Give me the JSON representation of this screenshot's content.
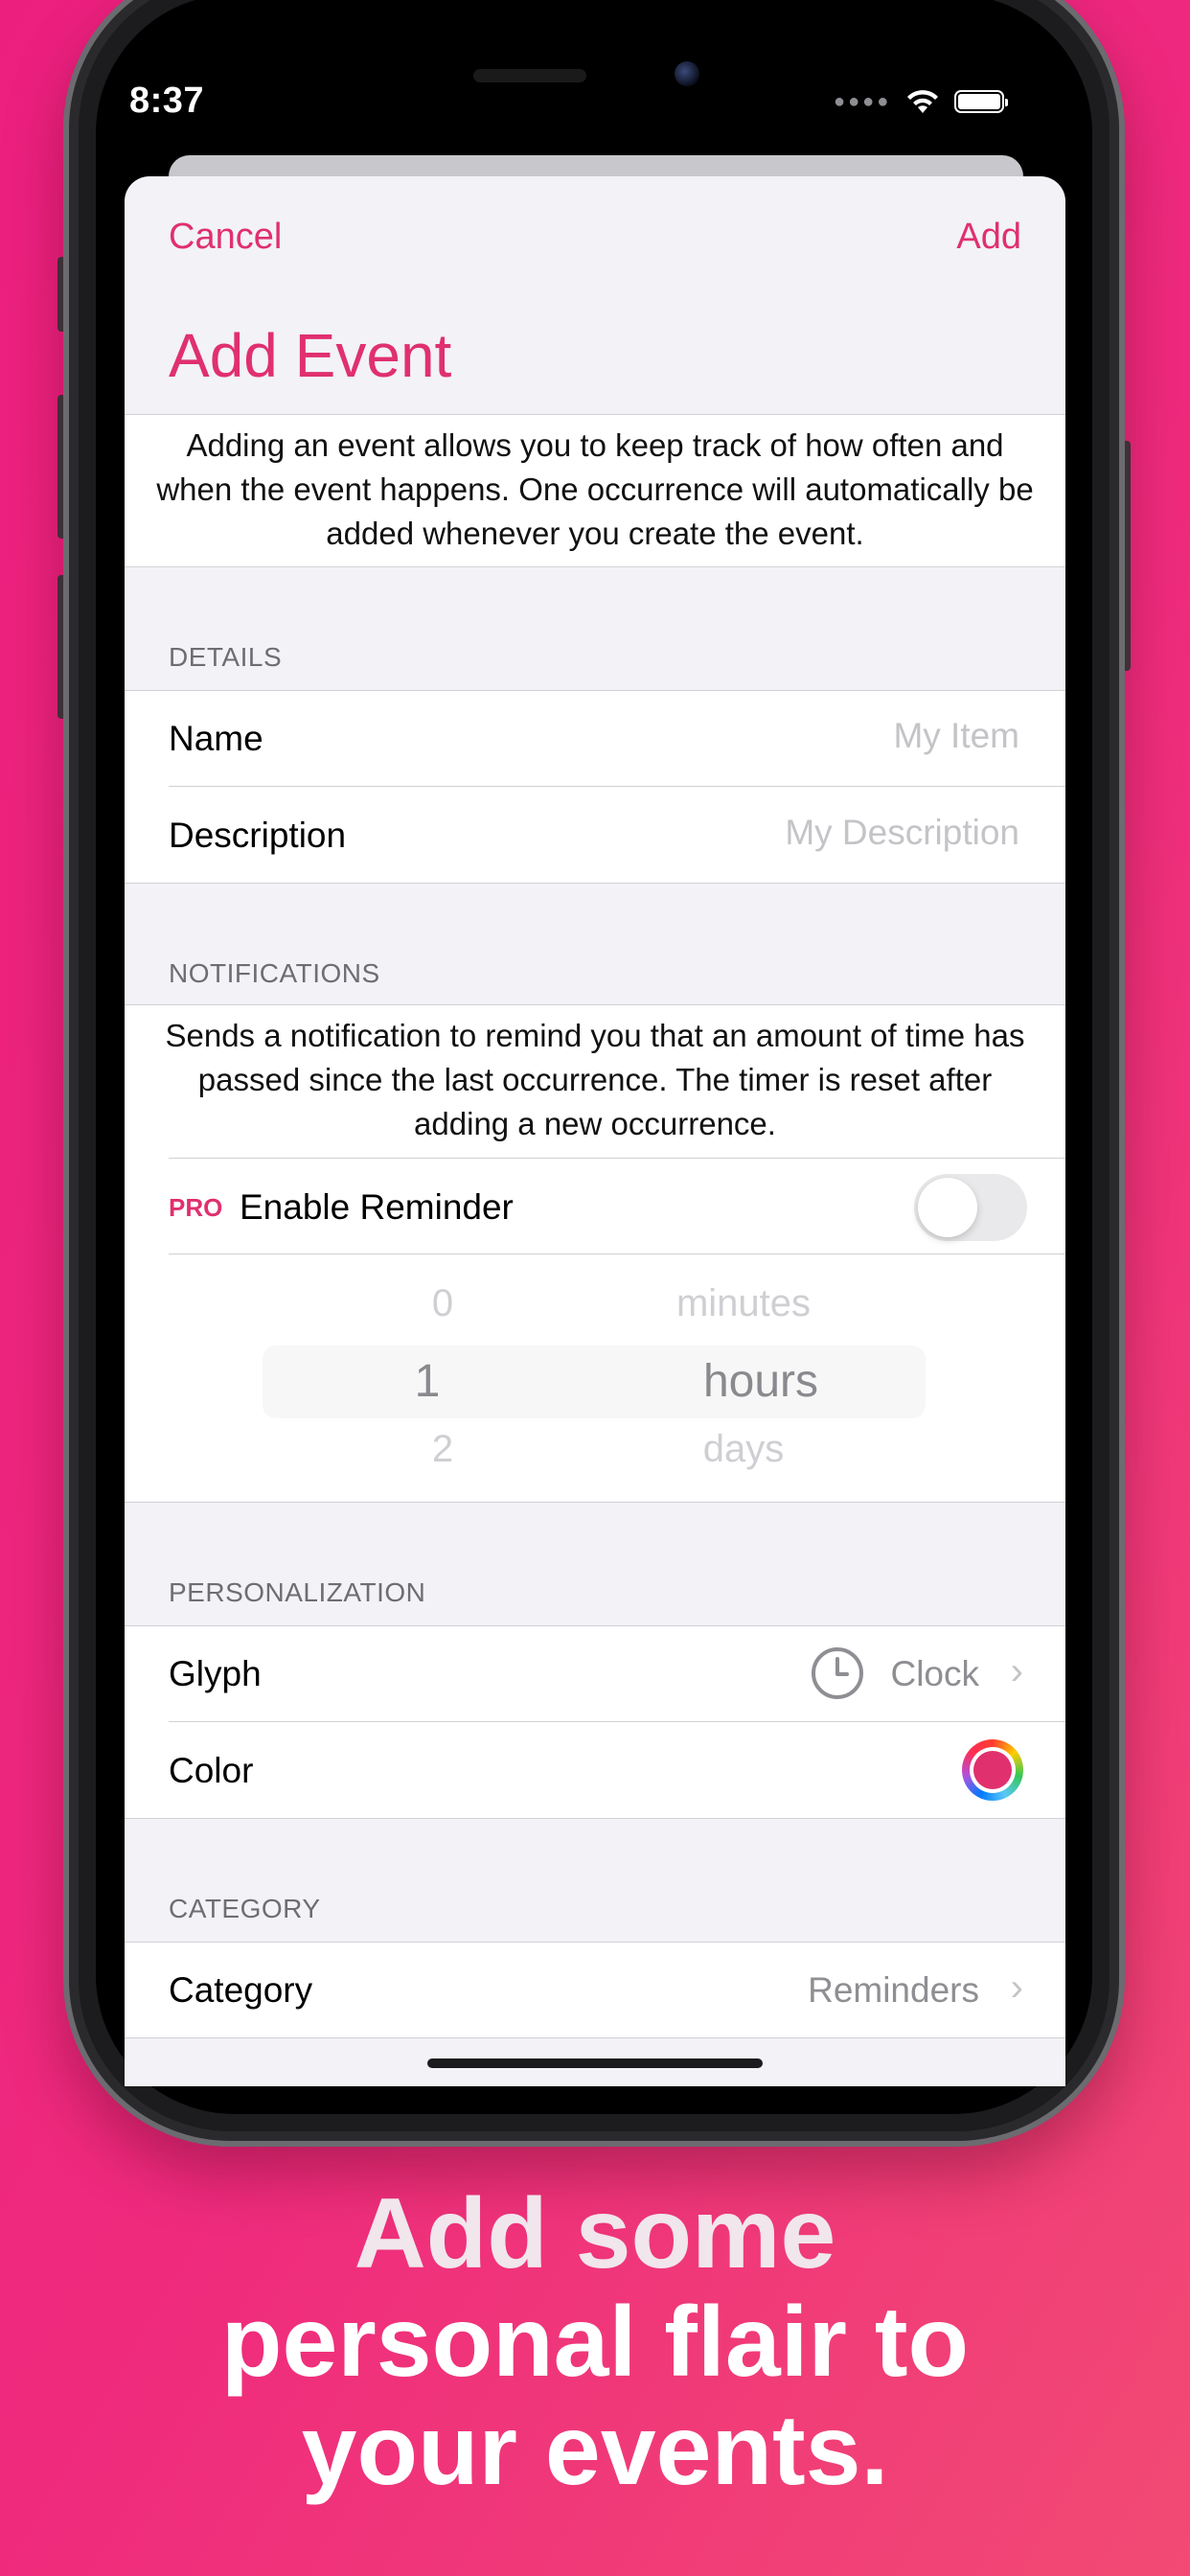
{
  "status_bar": {
    "time": "8:37"
  },
  "nav": {
    "cancel_label": "Cancel",
    "add_label": "Add",
    "title": "Add Event"
  },
  "intro_text": "Adding an event allows you to keep track of how often and when the event happens. One occurrence will automatically be added whenever you create the event.",
  "details": {
    "header": "DETAILS",
    "name_label": "Name",
    "name_placeholder": "My Item",
    "description_label": "Description",
    "description_placeholder": "My Description"
  },
  "notifications": {
    "header": "NOTIFICATIONS",
    "text": "Sends a notification to remind you that an amount of time has passed since the last occurrence. The timer is reset after adding a new occurrence.",
    "pro_badge": "PRO",
    "reminder_label": "Enable Reminder",
    "reminder_enabled": false,
    "picker": {
      "numbers": [
        "0",
        "1",
        "2"
      ],
      "units": [
        "minutes",
        "hours",
        "days"
      ],
      "selected_number": "1",
      "selected_unit": "hours"
    }
  },
  "personalization": {
    "header": "PERSONALIZATION",
    "glyph_label": "Glyph",
    "glyph_value": "Clock",
    "glyph_icon": "clock-icon",
    "color_label": "Color",
    "color_value": "#e0306e"
  },
  "category": {
    "header": "CATEGORY",
    "label": "Category",
    "value": "Reminders"
  },
  "caption": {
    "line1": "Add some",
    "line2": "personal flair to",
    "line3": "your events."
  },
  "colors": {
    "accent": "#e0306e",
    "background": "#ec1f7f"
  }
}
